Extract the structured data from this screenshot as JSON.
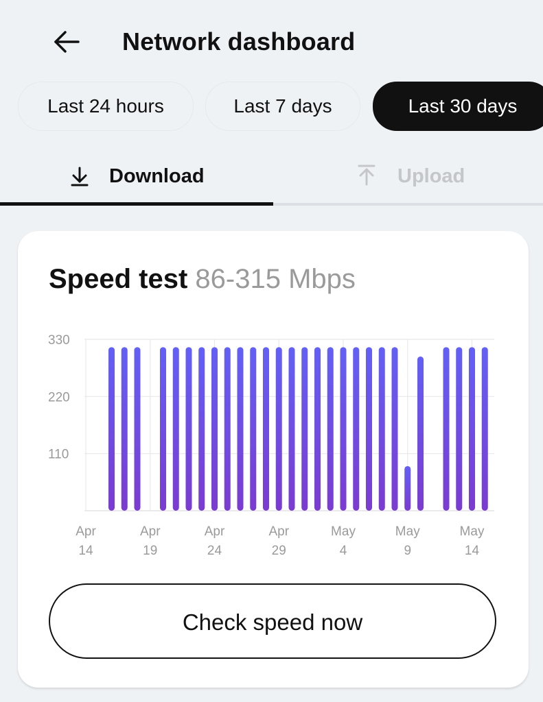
{
  "header": {
    "back_icon": "arrow-left-icon",
    "title": "Network dashboard"
  },
  "time_filters": [
    {
      "label": "Last 24 hours",
      "active": false
    },
    {
      "label": "Last 7 days",
      "active": false
    },
    {
      "label": "Last 30 days",
      "active": true
    }
  ],
  "tabs": [
    {
      "label": "Download",
      "icon": "arrow-down-icon",
      "active": true
    },
    {
      "label": "Upload",
      "icon": "arrow-up-icon",
      "active": false
    }
  ],
  "colors": {
    "bar_top": "#6360f5",
    "bar_bottom": "#7b3bd0",
    "active_chip": "#111111",
    "inactive_tab": "#c4c6c9",
    "axis_text": "#9a9a9a"
  },
  "card": {
    "title": "Speed test",
    "range": "86-315 Mbps",
    "button_label": "Check speed now"
  },
  "chart_data": {
    "type": "bar",
    "title": "Speed test 86-315 Mbps",
    "xlabel": "",
    "ylabel": "Mbps",
    "ylim": [
      0,
      330
    ],
    "yticks": [
      110,
      220,
      330
    ],
    "grid": true,
    "x_range_days": [
      "Apr 14",
      "May 15"
    ],
    "xtick_labels": [
      {
        "line1": "Apr",
        "line2": "14",
        "day": 0
      },
      {
        "line1": "Apr",
        "line2": "19",
        "day": 5
      },
      {
        "line1": "Apr",
        "line2": "24",
        "day": 10
      },
      {
        "line1": "Apr",
        "line2": "29",
        "day": 15
      },
      {
        "line1": "May",
        "line2": "4",
        "day": 20
      },
      {
        "line1": "May",
        "line2": "9",
        "day": 25
      },
      {
        "line1": "May",
        "line2": "14",
        "day": 30
      }
    ],
    "categories": [
      "Apr 16",
      "Apr 17",
      "Apr 18",
      "Apr 20",
      "Apr 21",
      "Apr 22",
      "Apr 23",
      "Apr 24",
      "Apr 25",
      "Apr 26",
      "Apr 27",
      "Apr 28",
      "Apr 29",
      "Apr 30",
      "May 1",
      "May 2",
      "May 3",
      "May 4",
      "May 5",
      "May 6",
      "May 7",
      "May 8",
      "May 9",
      "May 10",
      "May 12",
      "May 13",
      "May 14",
      "May 15"
    ],
    "day_index": [
      2,
      3,
      4,
      6,
      7,
      8,
      9,
      10,
      11,
      12,
      13,
      14,
      15,
      16,
      17,
      18,
      19,
      20,
      21,
      22,
      23,
      24,
      25,
      26,
      28,
      29,
      30,
      31
    ],
    "values": [
      315,
      315,
      315,
      315,
      315,
      315,
      315,
      315,
      315,
      315,
      315,
      315,
      315,
      315,
      315,
      315,
      315,
      315,
      315,
      315,
      315,
      315,
      86,
      297,
      315,
      315,
      315,
      315
    ]
  }
}
